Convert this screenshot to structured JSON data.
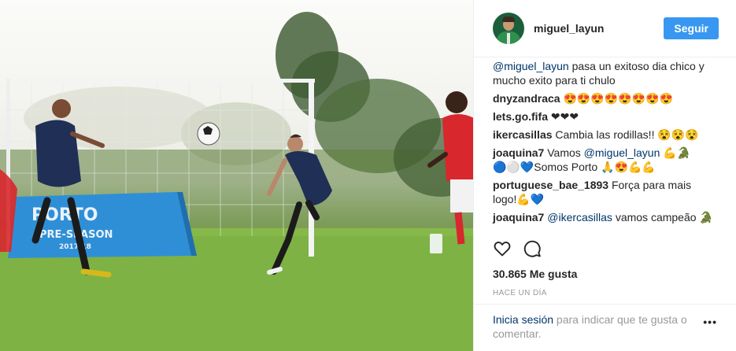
{
  "post": {
    "image_alt": "",
    "board_text": "PORTO",
    "board_sub": "PRE-SEASON",
    "board_year": "2017/18"
  },
  "header": {
    "username": "miguel_layun",
    "follow_label": "Seguir"
  },
  "comments": [
    {
      "author": "",
      "mention": "@miguel_layun",
      "text": " pasa un exitoso dia chico y mucho exito para ti chulo"
    },
    {
      "author": "dnyzandraca",
      "mention": "",
      "text": " 😍😍😍😍😍😍😍😍"
    },
    {
      "author": "lets.go.fifa",
      "mention": "",
      "text": " ❤❤❤"
    },
    {
      "author": "ikercasillas",
      "mention": "",
      "text": " Cambia las rodillas!! 😵😵😵"
    },
    {
      "author": "joaquina7",
      "text_before": " Vamos ",
      "mention": "@miguel_layun",
      "text": " 💪🐊🔵⚪💙Somos Porto 🙏😍💪💪"
    },
    {
      "author": "portuguese_bae_1893",
      "mention": "",
      "text": " Força para mais logo!💪💙"
    },
    {
      "author": "joaquina7",
      "mention": "@ikercasillas",
      "text": " vamos campeão 🐊"
    }
  ],
  "actions": {
    "like_icon": "heart-icon",
    "comment_icon": "comment-icon"
  },
  "likes": "30.865 Me gusta",
  "time": "HACE UN DÍA",
  "footer": {
    "login": "Inicia sesión",
    "rest": " para indicar que te gusta o comentar.",
    "more_icon": "more-options-icon"
  }
}
